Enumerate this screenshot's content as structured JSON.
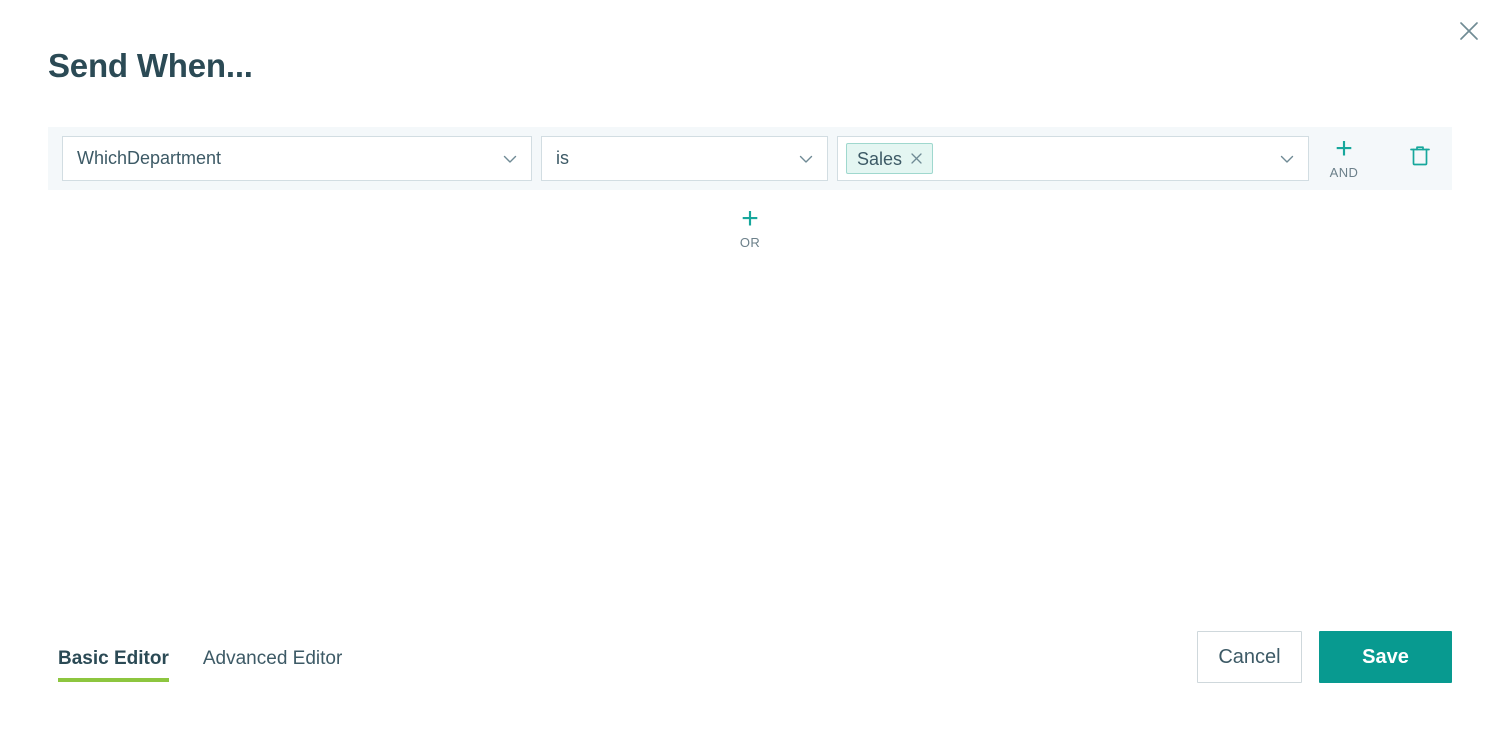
{
  "dialog": {
    "title": "Send When...",
    "close_icon": "close-icon"
  },
  "filter": {
    "rows": [
      {
        "attribute": {
          "value": "WhichDepartment",
          "icon": "chevron-down-icon"
        },
        "operator": {
          "value": "is",
          "icon": "chevron-down-icon"
        },
        "value_field": {
          "icon": "chevron-down-icon",
          "chips": [
            {
              "label": "Sales",
              "remove_icon": "close-icon"
            }
          ]
        },
        "add_and": {
          "plus": "+",
          "label": "AND",
          "icon": "plus-icon"
        },
        "delete": {
          "icon": "trash-icon"
        }
      }
    ],
    "add_or": {
      "plus": "+",
      "label": "OR",
      "icon": "plus-icon"
    }
  },
  "footer": {
    "tabs": [
      {
        "label": "Basic Editor",
        "active": true
      },
      {
        "label": "Advanced Editor",
        "active": false
      }
    ],
    "cancel_label": "Cancel",
    "save_label": "Save"
  },
  "colors": {
    "title": "#2b4a55",
    "teal": "#17a79c",
    "save_teal": "#089a90",
    "green_underline": "#8dc63f",
    "band": "#f4f8fa",
    "chip_bg": "#e4f6f2",
    "chip_border": "#9fd8ce",
    "field_border": "#d2dde2",
    "text": "#3d5a66",
    "muted": "#6c808a"
  }
}
